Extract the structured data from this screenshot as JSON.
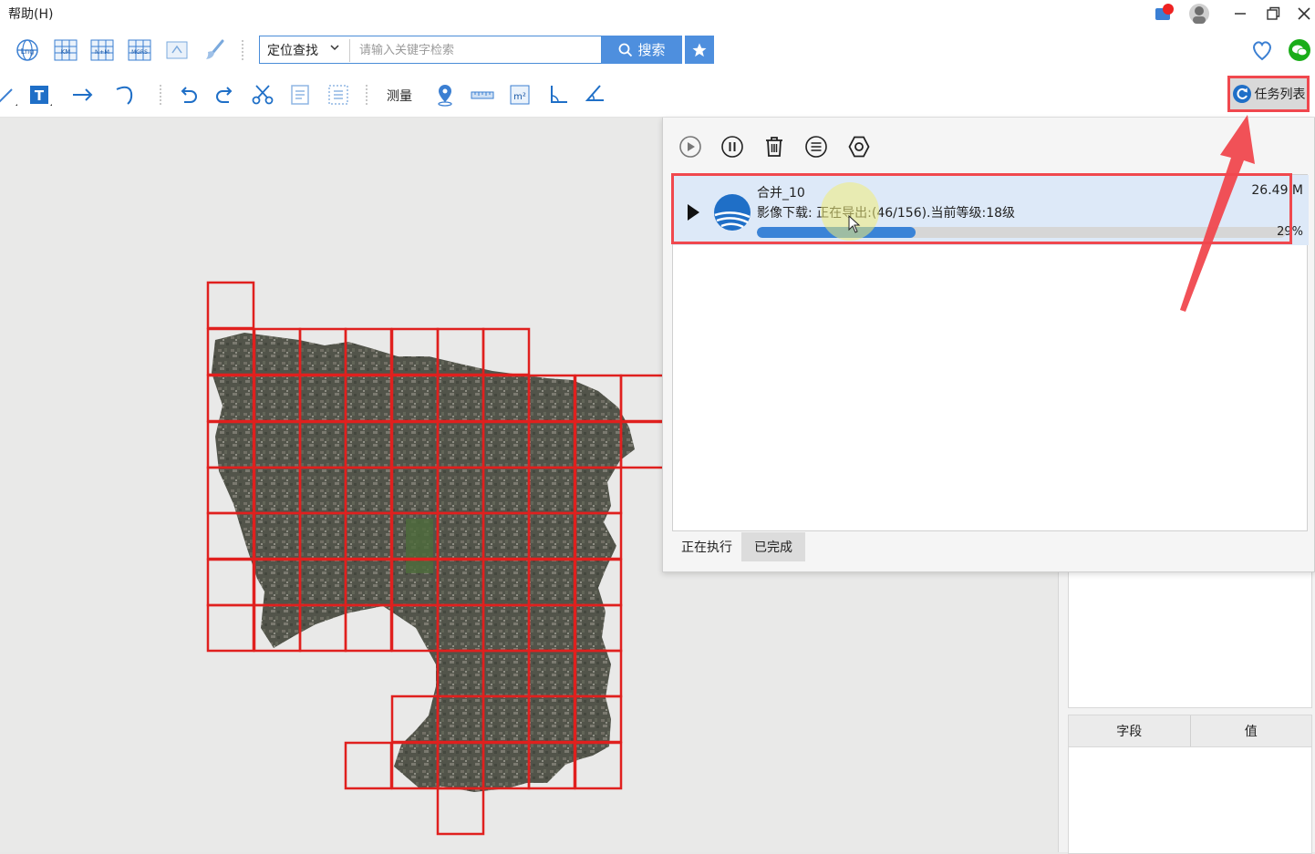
{
  "menu": {
    "help_label": "帮助(H)"
  },
  "toolbar1": {
    "icon_labels": [
      "Lng",
      "KM",
      "N+M",
      "MGRS"
    ],
    "search": {
      "select_value": "定位查找",
      "placeholder": "请输入关键字检索",
      "button_label": "搜索"
    }
  },
  "toolbar2": {
    "measure_label": "测量",
    "tasklist_label": "任务列表"
  },
  "task_panel": {
    "task": {
      "name": "合并_10",
      "status": "影像下载:  正在导出:(46/156).当前等级:18级",
      "size": "26.49 M",
      "percent_text": "29%",
      "progress": 0.3
    },
    "tabs": {
      "running": "正在执行",
      "done": "已完成"
    }
  },
  "attr_table": {
    "col_field": "字段",
    "col_value": "值"
  },
  "colors": {
    "accent": "#4e8fde",
    "progress": "#3a83d7",
    "annotation": "#f0484e",
    "grid": "#e0201e"
  }
}
